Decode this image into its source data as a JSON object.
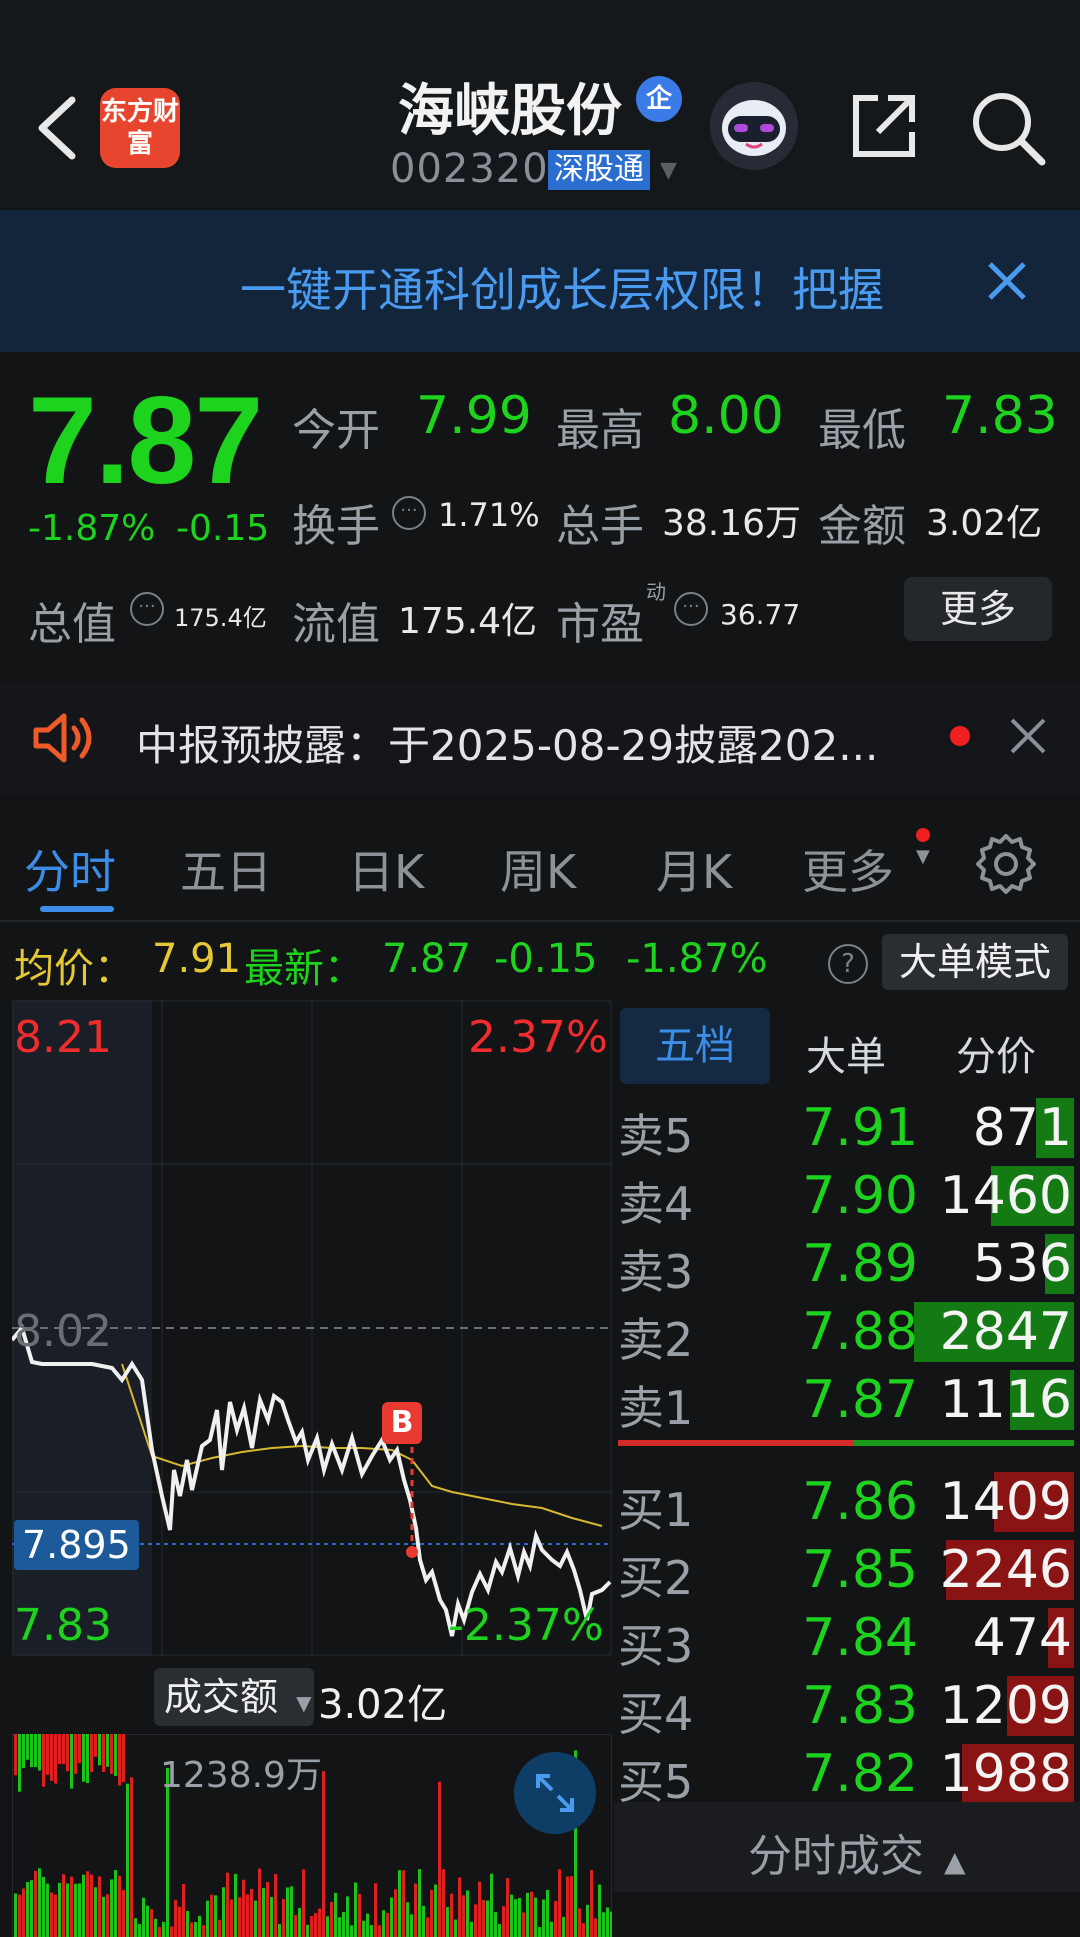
{
  "header": {
    "title": "海峡股份",
    "enterprise_badge": "企",
    "code": "002320",
    "tag": "深股通",
    "logo_text": "东方财富"
  },
  "banner": {
    "text": "一键开通科创成长层权限！把握"
  },
  "quote": {
    "price": "7.87",
    "change_pct": "-1.87%",
    "change": "-0.15",
    "open_label": "今开",
    "open": "7.99",
    "high_label": "最高",
    "high": "8.00",
    "low_label": "最低",
    "low": "7.83",
    "turnover_label": "换手",
    "turnover": "1.71%",
    "volume_label": "总手",
    "volume": "38.16万",
    "amount_label": "金额",
    "amount": "3.02亿",
    "mktcap_label": "总值",
    "mktcap": "175.4亿",
    "float_label": "流值",
    "float": "175.4亿",
    "pe_label": "市盈",
    "pe_sup": "动",
    "pe": "36.77",
    "more_label": "更多",
    "dots": "···"
  },
  "notice": {
    "text": "中报预披露：于2025-08-29披露202..."
  },
  "tabs": [
    "分时",
    "五日",
    "日K",
    "周K",
    "月K",
    "更多"
  ],
  "info_row": {
    "avg_label": "均价：",
    "avg": "7.91",
    "new_label": "最新：",
    "new": "7.87",
    "new_chg": "-0.15",
    "new_pct": "-1.87%",
    "help": "?",
    "big_order_btn": "大单模式"
  },
  "chart": {
    "price_high": "8.21",
    "pct_high": "2.37%",
    "ref_price": "8.02",
    "current_marker": "7.895",
    "price_low": "7.83",
    "pct_low": "-2.37%",
    "b_marker": "B",
    "volume_label": "成交额",
    "volume_value": "3.02亿",
    "volume_max": "1238.9万"
  },
  "orderbook": {
    "tabs": [
      "五档",
      "大单",
      "分价"
    ],
    "asks": [
      {
        "label": "卖5",
        "price": "7.91",
        "vol": "871",
        "ratio": 0.12
      },
      {
        "label": "卖4",
        "price": "7.90",
        "vol": "1460",
        "ratio": 0.26
      },
      {
        "label": "卖3",
        "price": "7.89",
        "vol": "536",
        "ratio": 0.09
      },
      {
        "label": "卖2",
        "price": "7.88",
        "vol": "2847",
        "ratio": 0.5
      },
      {
        "label": "卖1",
        "price": "7.87",
        "vol": "1116",
        "ratio": 0.2
      }
    ],
    "bids": [
      {
        "label": "买1",
        "price": "7.86",
        "vol": "1409",
        "ratio": 0.25
      },
      {
        "label": "买2",
        "price": "7.85",
        "vol": "2246",
        "ratio": 0.4
      },
      {
        "label": "买3",
        "price": "7.84",
        "vol": "474",
        "ratio": 0.08
      },
      {
        "label": "买4",
        "price": "7.83",
        "vol": "1209",
        "ratio": 0.21
      },
      {
        "label": "买5",
        "price": "7.82",
        "vol": "1988",
        "ratio": 0.35
      }
    ],
    "footer": "分时成交"
  },
  "colors": {
    "up": "#f02c2c",
    "down": "#1ed31e",
    "accent": "#3b8de8",
    "avg_line": "#e6c836"
  }
}
